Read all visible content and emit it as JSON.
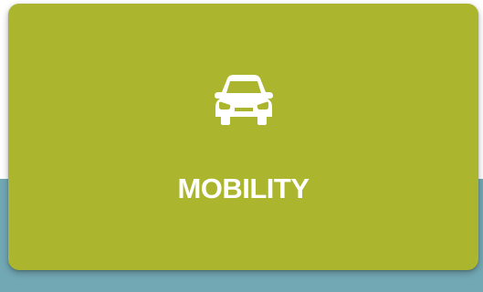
{
  "background": {
    "top_color": "#ffffff",
    "band_color": "#72a8b4"
  },
  "card": {
    "label": "MOBILITY",
    "icon": "car-icon",
    "color": "#abb52d",
    "text_color": "#ffffff"
  }
}
